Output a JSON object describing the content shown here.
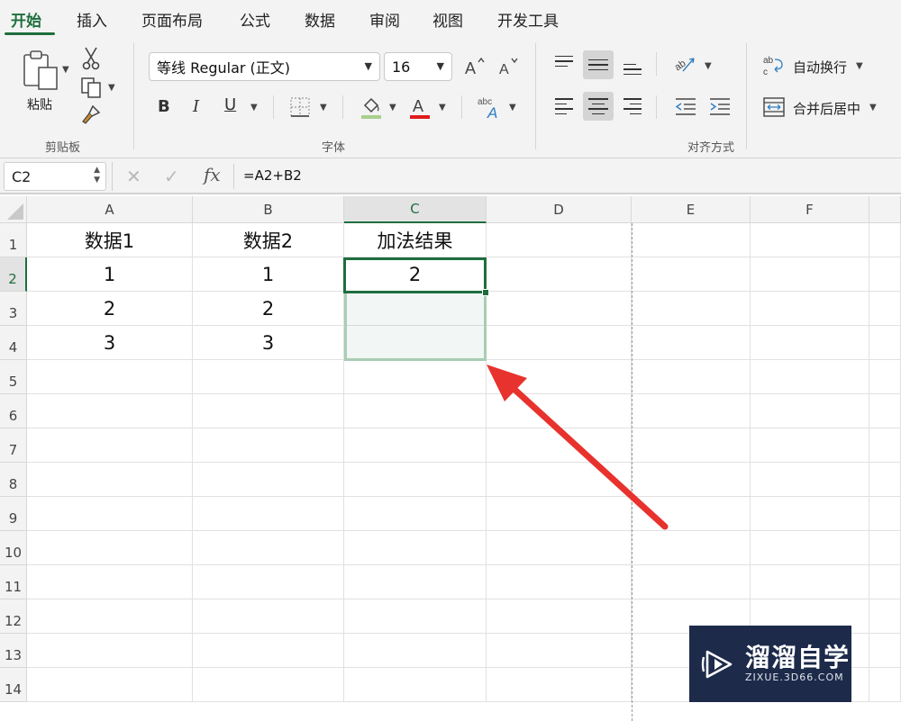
{
  "tabs": [
    {
      "label": "开始",
      "active": true
    },
    {
      "label": "插入"
    },
    {
      "label": "页面布局"
    },
    {
      "label": "公式"
    },
    {
      "label": "数据"
    },
    {
      "label": "审阅"
    },
    {
      "label": "视图"
    },
    {
      "label": "开发工具"
    }
  ],
  "ribbon": {
    "clipboard": {
      "paste_label": "粘贴",
      "group_label": "剪贴板"
    },
    "font": {
      "font_name": "等线 Regular (正文)",
      "font_size": "16",
      "bold": "B",
      "italic": "I",
      "underline": "U",
      "font_color_letter": "A",
      "group_label": "字体"
    },
    "alignment": {
      "wrap_text_label": "自动换行",
      "merge_center_label": "合并后居中",
      "group_label": "对齐方式"
    }
  },
  "formula_bar": {
    "name_box": "C2",
    "formula": "=A2+B2",
    "fx": "fx"
  },
  "grid": {
    "columns": [
      "A",
      "B",
      "C",
      "D",
      "E",
      "F"
    ],
    "rows": [
      "1",
      "2",
      "3",
      "4",
      "5",
      "6",
      "7",
      "8",
      "9",
      "10",
      "11",
      "12",
      "13",
      "14"
    ],
    "cells": {
      "A1": "数据1",
      "B1": "数据2",
      "C1": "加法结果",
      "A2": "1",
      "B2": "1",
      "C2": "2",
      "A3": "2",
      "B3": "2",
      "A4": "3",
      "B4": "3"
    },
    "active_cell": "C2",
    "selected_range": "C2:C4"
  },
  "colors": {
    "accent": "#1e6e3d",
    "arrow": "#e8322d",
    "watermark_bg": "#1d2a4a"
  },
  "watermark": {
    "title": "溜溜自学",
    "subtitle": "ZIXUE.3D66.COM"
  }
}
